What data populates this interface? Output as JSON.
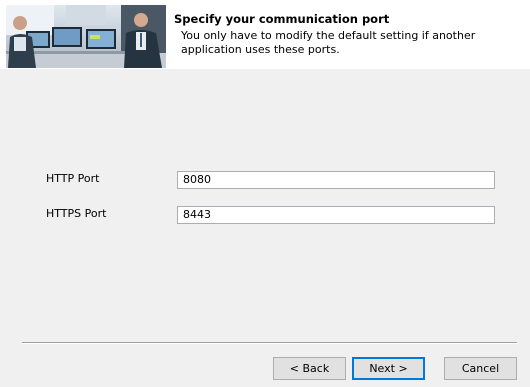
{
  "header": {
    "title": "Specify your communication port",
    "description": "You only have to modify the default setting if another application uses these ports."
  },
  "fields": {
    "http": {
      "label": "HTTP Port",
      "value": "8080"
    },
    "https": {
      "label": "HTTPS Port",
      "value": "8443"
    }
  },
  "buttons": {
    "back": "< Back",
    "next": "Next >",
    "cancel": "Cancel"
  },
  "colors": {
    "window_bg": "#f0f0f0",
    "header_bg": "#ffffff",
    "focus_border": "#0078d7"
  }
}
